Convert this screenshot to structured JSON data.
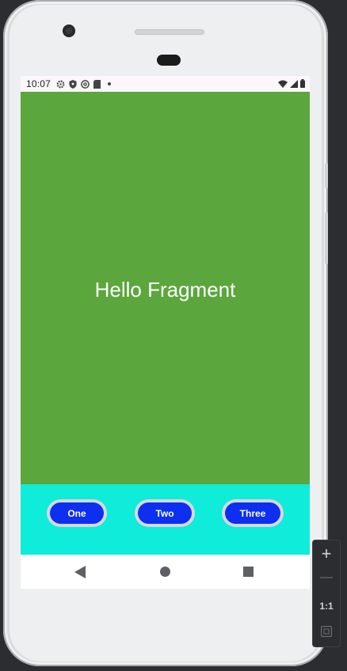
{
  "status_bar": {
    "time": "10:07",
    "left_icons": [
      "gear-icon",
      "shield-icon",
      "at-sign-icon",
      "sd-card-icon",
      "dot-icon"
    ],
    "right_icons": [
      "wifi-icon",
      "signal-icon",
      "battery-icon"
    ]
  },
  "fragment": {
    "text": "Hello Fragment",
    "background": "#5ba63d"
  },
  "buttons": [
    {
      "label": "One"
    },
    {
      "label": "Two"
    },
    {
      "label": "Three"
    }
  ],
  "button_bar": {
    "background": "#0fecd9",
    "button_color": "#0c2ff0"
  },
  "nav_bar": {
    "icons": [
      "back-icon",
      "home-icon",
      "recents-icon"
    ]
  },
  "zoom_toolbar": {
    "zoom_in": "+",
    "zoom_out": "—",
    "actual_size": "1:1",
    "fit_icon": "fit-screen-icon"
  }
}
